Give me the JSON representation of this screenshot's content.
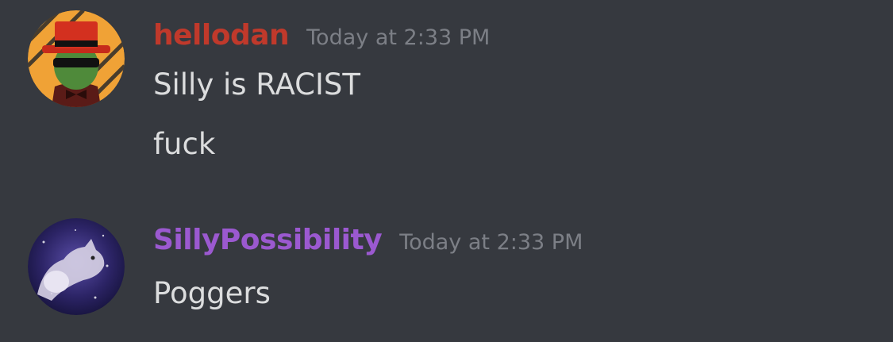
{
  "colors": {
    "background": "#36393f",
    "hellodan_name": "#c0392b",
    "sillypossibility_name": "#9b59d0",
    "timestamp": "#7c7f86",
    "message_text": "#dcddde"
  },
  "messages": [
    {
      "author": "hellodan",
      "timestamp": "Today at 2:33 PM",
      "avatar": "cactus-top-hat-avatar",
      "lines": [
        "Silly is RACIST",
        "fuck"
      ]
    },
    {
      "author": "SillyPossibility",
      "timestamp": "Today at 2:33 PM",
      "avatar": "space-cat-avatar",
      "lines": [
        "Poggers"
      ]
    }
  ]
}
